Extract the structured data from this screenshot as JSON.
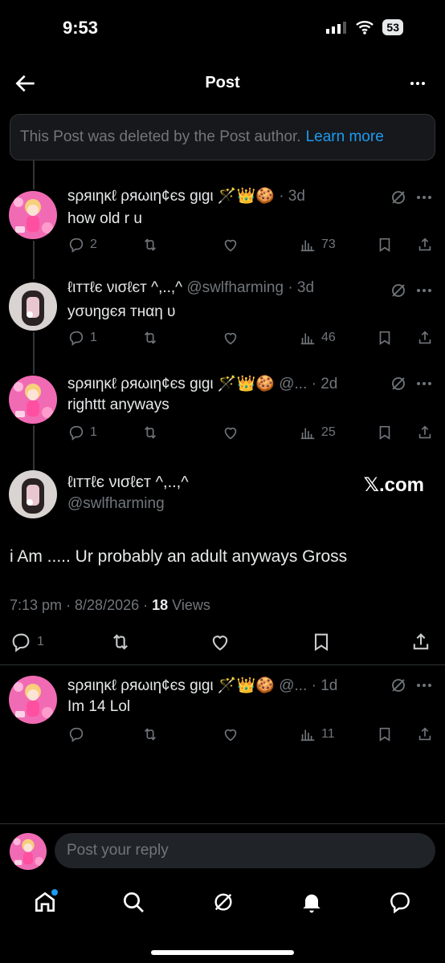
{
  "status_bar": {
    "time": "9:53",
    "battery": "53"
  },
  "header": {
    "title": "Post"
  },
  "deleted_notice": {
    "text": "This Post was deleted by the Post author.",
    "link": "Learn more"
  },
  "thread": [
    {
      "name": "ѕρяιηκℓ ρяωιη¢єѕ gιgι 🪄👑🍪",
      "handle": "",
      "time": "· 3d",
      "text": "how old r u",
      "replies": "2",
      "reposts": "",
      "likes": "",
      "views": "73"
    },
    {
      "name": "ℓιттℓє νισℓєт ^,..,^",
      "handle": "@swlfharming",
      "time": "· 3d",
      "text": "уσυηgєя тнαη υ",
      "replies": "1",
      "reposts": "",
      "likes": "",
      "views": "46"
    },
    {
      "name": "ѕρяιηκℓ ρяωιη¢єѕ gιgι 🪄👑🍪",
      "handle": "@...",
      "time": "· 2d",
      "text": "righttt anyways",
      "replies": "1",
      "reposts": "",
      "likes": "",
      "views": "25"
    }
  ],
  "main_post": {
    "name": "ℓιттℓє νισℓєт ^,..,^",
    "handle": "@swlfharming",
    "source": "𝕏.com",
    "text": "i Am ..... Ur probably an adult anyways Gross",
    "time": "7:13 pm · 8/28/2026 · ",
    "views_count": "18",
    "views_label": " Views",
    "replies": "1"
  },
  "reply": {
    "name": "ѕρяιηκℓ ρяωιη¢єѕ gιgι 🪄👑🍪",
    "handle": "@...",
    "time": "· 1d",
    "text": "Im 14 Lol",
    "replies": "",
    "views": "11"
  },
  "composer": {
    "placeholder": "Post your reply"
  },
  "tabs": [
    "home-icon",
    "search-icon",
    "grok-icon",
    "notifications-icon",
    "messages-icon"
  ],
  "colors": {
    "accent": "#1d9bf0",
    "background": "#000000",
    "muted": "#71767b"
  }
}
